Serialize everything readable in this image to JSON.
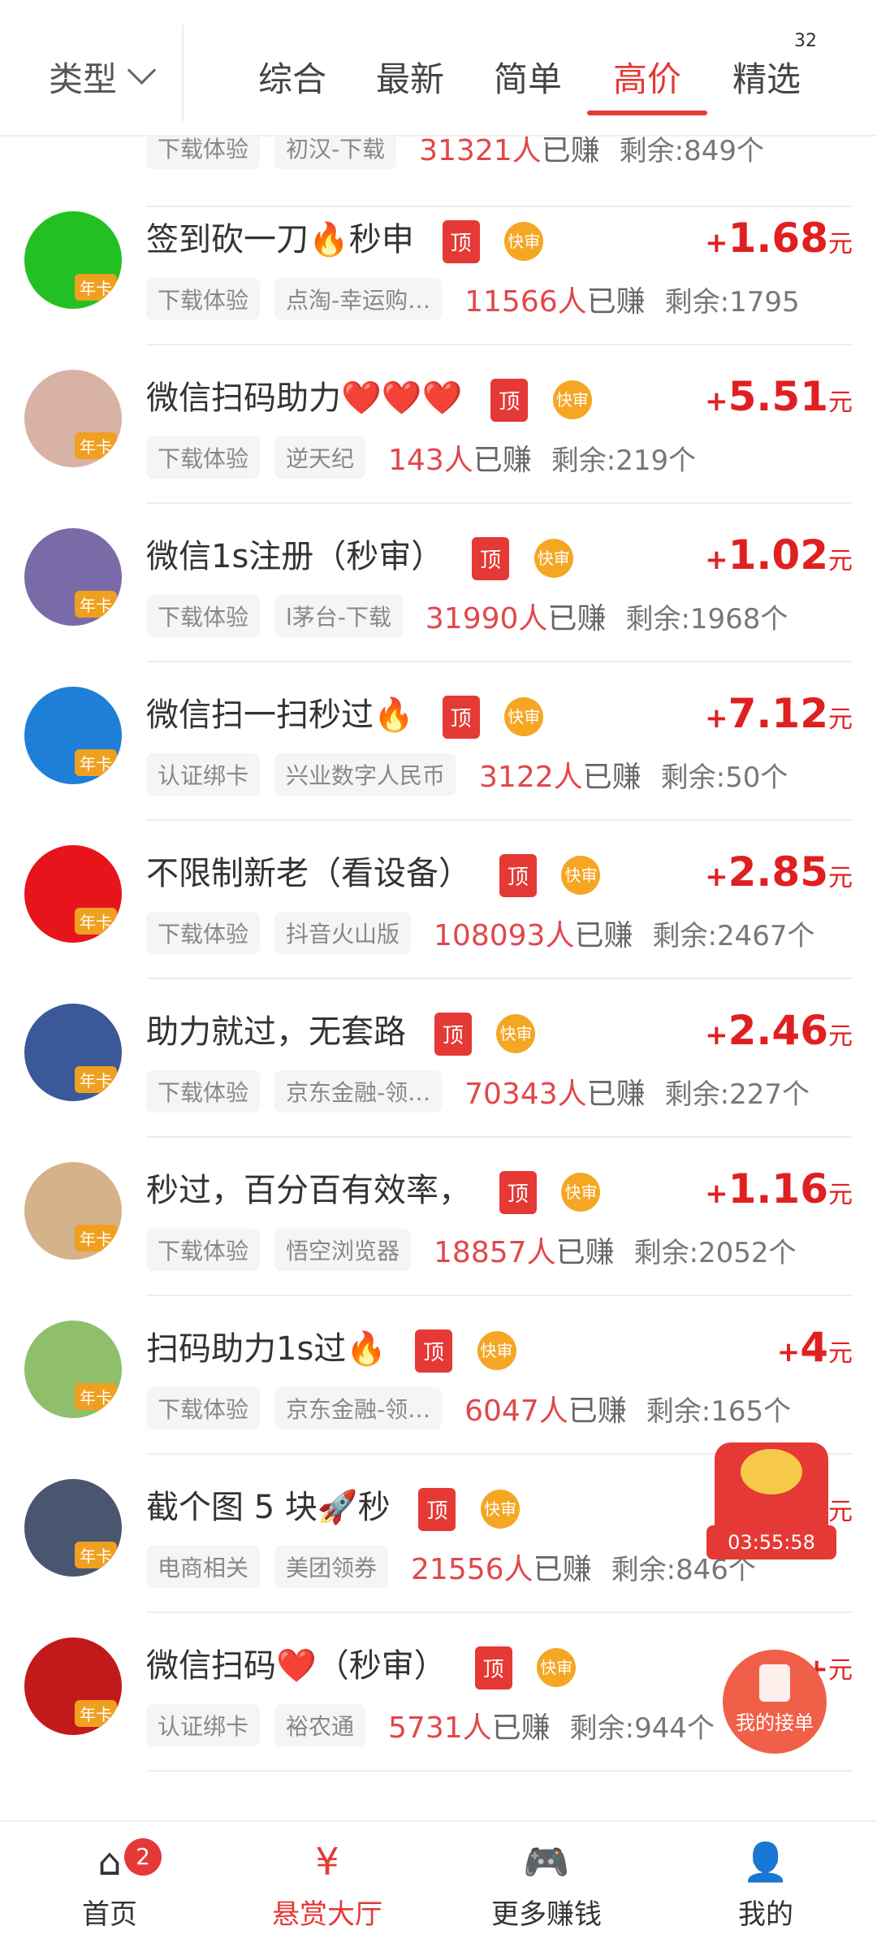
{
  "header": {
    "type_label": "类型",
    "tabs": [
      "综合",
      "最新",
      "简单",
      "高价",
      "精选"
    ],
    "active_tab": "高价",
    "badge": "32"
  },
  "partial_top": {
    "chip1": "下载体验",
    "chip2": "初汉-下载",
    "earned": "31321人",
    "earned_suffix": "已赚",
    "remain": "剩余:849个"
  },
  "tasks": [
    {
      "title": "签到砍一刀🔥秒申",
      "tag_top": "顶",
      "tag_fast": "快审",
      "chip1": "下载体验",
      "chip2": "点淘-幸运购…",
      "earned": "11566人",
      "earned_suffix": "已赚",
      "remain": "剩余:1795",
      "price": "1.68",
      "unit": "元",
      "avatar": "#22c022",
      "badge": "年卡"
    },
    {
      "title": "微信扫码助力❤️❤️❤️",
      "tag_top": "顶",
      "tag_fast": "快审",
      "chip1": "下载体验",
      "chip2": "逆天纪",
      "earned": "143人",
      "earned_suffix": "已赚",
      "remain": "剩余:219个",
      "price": "5.51",
      "unit": "元",
      "avatar": "#d9b2a6",
      "badge": "年卡"
    },
    {
      "title": "微信1s注册（秒审）",
      "tag_top": "顶",
      "tag_fast": "快审",
      "chip1": "下载体验",
      "chip2": "l茅台-下载",
      "earned": "31990人",
      "earned_suffix": "已赚",
      "remain": "剩余:1968个",
      "price": "1.02",
      "unit": "元",
      "avatar": "#7a6aa8",
      "badge": "年卡"
    },
    {
      "title": "微信扫一扫秒过🔥",
      "tag_top": "顶",
      "tag_fast": "快审",
      "chip1": "认证绑卡",
      "chip2": "兴业数字人民币",
      "earned": "3122人",
      "earned_suffix": "已赚",
      "remain": "剩余:50个",
      "price": "7.12",
      "unit": "元",
      "avatar": "#1e7fd8",
      "badge": "年卡"
    },
    {
      "title": "不限制新老（看设备）",
      "tag_top": "顶",
      "tag_fast": "快审",
      "chip1": "下载体验",
      "chip2": "抖音火山版",
      "earned": "108093人",
      "earned_suffix": "已赚",
      "remain": "剩余:2467个",
      "price": "2.85",
      "unit": "元",
      "avatar": "#e8141b",
      "badge": "年卡"
    },
    {
      "title": "助力就过，无套路",
      "tag_top": "顶",
      "tag_fast": "快审",
      "chip1": "下载体验",
      "chip2": "京东金融-领…",
      "earned": "70343人",
      "earned_suffix": "已赚",
      "remain": "剩余:227个",
      "price": "2.46",
      "unit": "元",
      "avatar": "#3b5998",
      "badge": "年卡"
    },
    {
      "title": "秒过，百分百有效率，",
      "tag_top": "顶",
      "tag_fast": "快审",
      "chip1": "下载体验",
      "chip2": "悟空浏览器",
      "earned": "18857人",
      "earned_suffix": "已赚",
      "remain": "剩余:2052个",
      "price": "1.16",
      "unit": "元",
      "avatar": "#d4b38a",
      "badge": "年卡"
    },
    {
      "title": "扫码助力1s过🔥",
      "tag_top": "顶",
      "tag_fast": "快审",
      "chip1": "下载体验",
      "chip2": "京东金融-领…",
      "earned": "6047人",
      "earned_suffix": "已赚",
      "remain": "剩余:165个",
      "price": "4",
      "unit": "元",
      "avatar": "#8fbf6a",
      "badge": "年卡"
    },
    {
      "title": "截个图 5 块🚀秒",
      "tag_top": "顶",
      "tag_fast": "快审",
      "chip1": "电商相关",
      "chip2": "美团领券",
      "earned": "21556人",
      "earned_suffix": "已赚",
      "remain": "剩余:846个",
      "price": "",
      "unit": "元",
      "avatar": "#4a5670",
      "badge": "年卡"
    },
    {
      "title": "微信扫码❤️（秒审）",
      "tag_top": "顶",
      "tag_fast": "快审",
      "chip1": "认证绑卡",
      "chip2": "裕农通",
      "earned": "5731人",
      "earned_suffix": "已赚",
      "remain": "剩余:944个",
      "price": "",
      "unit": "元",
      "avatar": "#c21a1a",
      "badge": "年卡"
    }
  ],
  "float_timer": "03:55:58",
  "float_orders_label": "我的接单",
  "bottom_nav": [
    {
      "label": "首页",
      "icon": "⌂",
      "badge": "2"
    },
    {
      "label": "悬赏大厅",
      "icon": "¥"
    },
    {
      "label": "更多赚钱",
      "icon": "🎮"
    },
    {
      "label": "我的",
      "icon": "👤"
    }
  ]
}
